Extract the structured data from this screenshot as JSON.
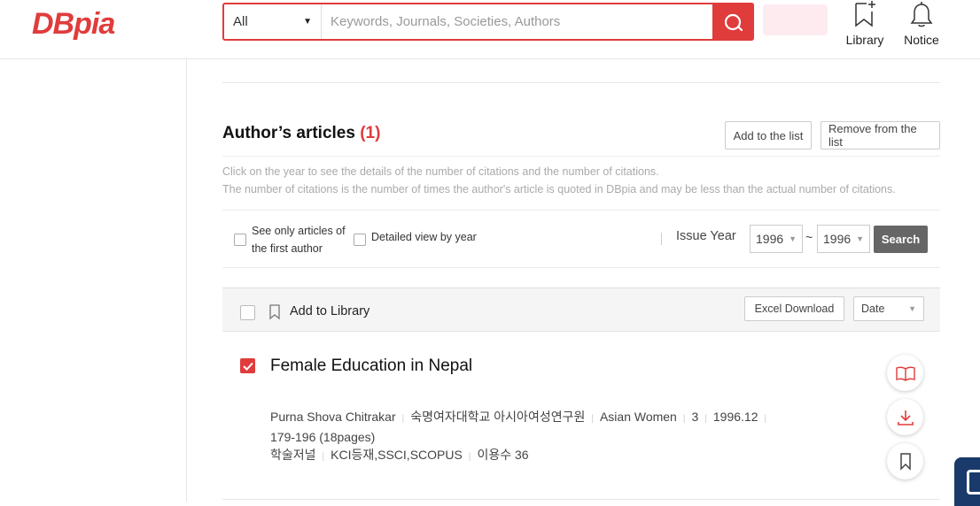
{
  "header": {
    "logo": "DBpia",
    "search_scope": "All",
    "search_placeholder": "Keywords, Journals, Societies, Authors",
    "library_label": "Library",
    "notice_label": "Notice"
  },
  "section": {
    "title": "Author’s articles",
    "count": "(1)",
    "add_list_label": "Add to the list",
    "remove_list_label": "Remove from the list",
    "notice_line1": "Click on the year to see the details of the number of citations and the number of citations.",
    "notice_line2": "The number of citations is the number of times the author's article is quoted in DBpia and may be less than the actual number of citations."
  },
  "filters": {
    "first_author_label": "See only articles of the first author",
    "detailed_view_label": "Detailed view by year",
    "issue_year_label": "Issue Year",
    "year_from": "1996",
    "year_to": "1996",
    "tilde": "~",
    "search_label": "Search"
  },
  "toolbar": {
    "add_library_label": "Add to Library",
    "excel_label": "Excel Download",
    "sort_value": "Date"
  },
  "article": {
    "checked": true,
    "title": "Female Education in Nepal",
    "author": "Purna Shova Chitrakar",
    "institute": "숙명여자대학교 아시아여성연구원",
    "journal": "Asian Women",
    "volume": "3",
    "date": "1996.12",
    "pages": "179-196 (18pages)",
    "type": "학술저널",
    "index": "KCI등재,SSCI,SCOPUS",
    "usage": "이용수 36"
  },
  "colors": {
    "brand": "#e03c3c",
    "dark_button": "#666666",
    "widget": "#1a3a6b"
  }
}
